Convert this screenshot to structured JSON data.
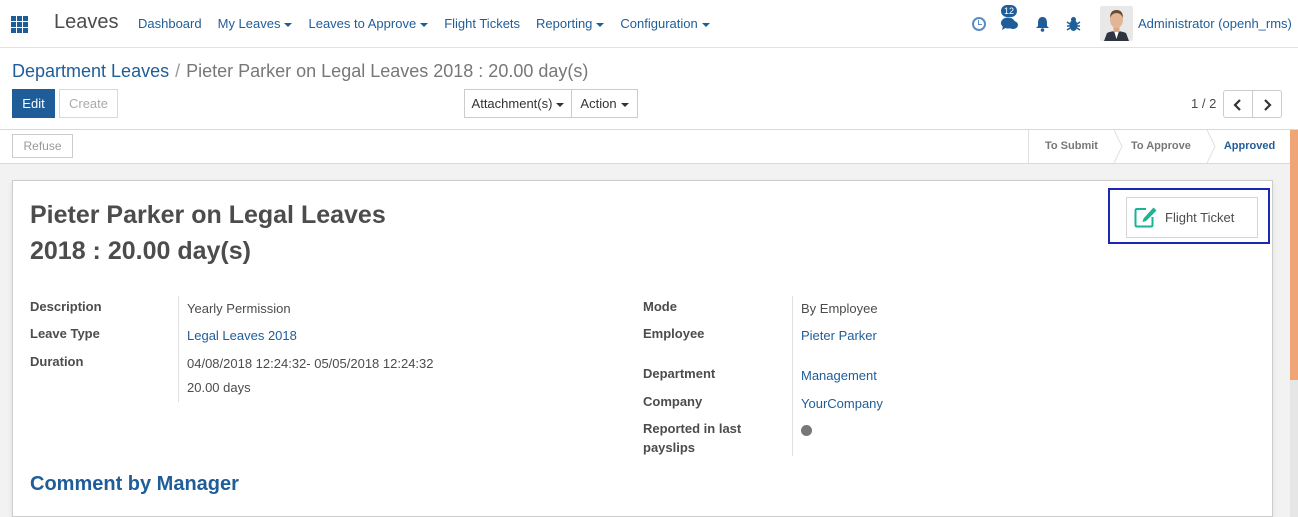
{
  "navbar": {
    "app_title": "Leaves",
    "menu": [
      {
        "label": "Dashboard",
        "dropdown": false
      },
      {
        "label": "My Leaves",
        "dropdown": true
      },
      {
        "label": "Leaves to Approve",
        "dropdown": true
      },
      {
        "label": "Flight Tickets",
        "dropdown": false
      },
      {
        "label": "Reporting",
        "dropdown": true
      },
      {
        "label": "Configuration",
        "dropdown": true
      }
    ],
    "message_count": "12",
    "user_name": "Administrator (openh_rms)",
    "icons": [
      "apps-grid-icon",
      "clock-icon",
      "chat-icon",
      "bell-icon",
      "bug-icon"
    ]
  },
  "breadcrumb": {
    "parent": "Department Leaves",
    "separator": "/",
    "current": "Pieter Parker on Legal Leaves 2018 : 20.00 day(s)"
  },
  "toolbar": {
    "edit_label": "Edit",
    "create_label": "Create",
    "attachments_label": "Attachment(s)",
    "action_label": "Action"
  },
  "pager": {
    "value": "1 / 2"
  },
  "statusbar": {
    "refuse_label": "Refuse",
    "stages": [
      {
        "label": "To Submit",
        "active": false
      },
      {
        "label": "To Approve",
        "active": false
      },
      {
        "label": "Approved",
        "active": true
      }
    ]
  },
  "record": {
    "title_line1": "Pieter Parker on Legal Leaves",
    "title_line2": "2018 : 20.00 day(s)",
    "flight_ticket_label": "Flight Ticket",
    "left_fields": {
      "description_label": "Description",
      "description_value": "Yearly Permission",
      "leave_type_label": "Leave Type",
      "leave_type_value": "Legal Leaves 2018",
      "duration_label": "Duration",
      "duration_range": "04/08/2018 12:24:32- 05/05/2018 12:24:32",
      "duration_days": "20.00 days"
    },
    "right_fields": {
      "mode_label": "Mode",
      "mode_value": "By Employee",
      "employee_label": "Employee",
      "employee_value": "Pieter Parker",
      "department_label": "Department",
      "department_value": "Management",
      "company_label": "Company",
      "company_value": "YourCompany",
      "reported_label_line1": "Reported in last",
      "reported_label_line2": "payslips"
    },
    "comment_title": "Comment by Manager"
  },
  "colors": {
    "brand": "#1f5d99",
    "highlight_box": "#1a26b4",
    "ticket_icon": "#1ab394"
  }
}
